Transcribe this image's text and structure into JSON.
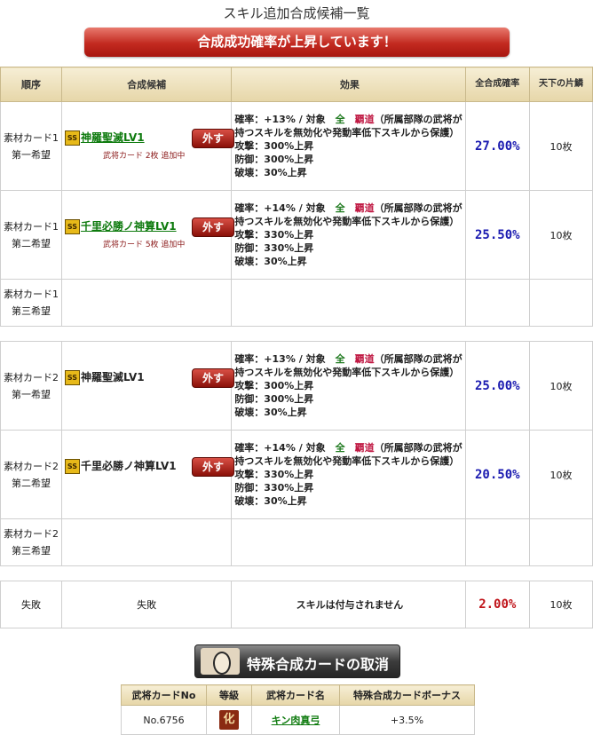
{
  "page_title": "スキル追加合成候補一覧",
  "banner": "合成成功確率が上昇しています！",
  "headers": {
    "order": "順序",
    "candidate": "合成候補",
    "effect": "効果",
    "total_rate": "全合成確率",
    "tenka": "天下の片鱗"
  },
  "rows": [
    {
      "order_line1": "素材カード1",
      "order_line2": "第一希望",
      "skill": "神羅聖滅LV1",
      "skill_linked": true,
      "sub": "武将カード 2枚 追加中",
      "remove": "外す",
      "effect": {
        "rate": "確率：+13%",
        "sep": "/",
        "target_label": "対象",
        "target": "全",
        "highlight": "覇道",
        "desc": "（所属部隊の武将が持つスキルを無効化や発動率低下スキルから保護）",
        "atk": "攻撃：300%上昇",
        "def": "防御：300%上昇",
        "brk": "破壊：30%上昇"
      },
      "total_rate": "27.00%",
      "tenka": "10枚"
    },
    {
      "order_line1": "素材カード1",
      "order_line2": "第二希望",
      "skill": "千里必勝ノ神算LV1",
      "skill_linked": true,
      "sub": "武将カード 5枚 追加中",
      "remove": "外す",
      "effect": {
        "rate": "確率：+14%",
        "sep": "/",
        "target_label": "対象",
        "target": "全",
        "highlight": "覇道",
        "desc": "（所属部隊の武将が持つスキルを無効化や発動率低下スキルから保護）",
        "atk": "攻撃：330%上昇",
        "def": "防御：330%上昇",
        "brk": "破壊：30%上昇"
      },
      "total_rate": "25.50%",
      "tenka": "10枚"
    },
    {
      "order_line1": "素材カード1",
      "order_line2": "第三希望"
    },
    {
      "order_line1": "素材カード2",
      "order_line2": "第一希望",
      "skill": "神羅聖滅LV1",
      "skill_linked": false,
      "sub": "",
      "remove": "外す",
      "effect": {
        "rate": "確率：+13%",
        "sep": "/",
        "target_label": "対象",
        "target": "全",
        "highlight": "覇道",
        "desc": "（所属部隊の武将が持つスキルを無効化や発動率低下スキルから保護）",
        "atk": "攻撃：300%上昇",
        "def": "防御：300%上昇",
        "brk": "破壊：30%上昇"
      },
      "total_rate": "25.00%",
      "tenka": "10枚"
    },
    {
      "order_line1": "素材カード2",
      "order_line2": "第二希望",
      "skill": "千里必勝ノ神算LV1",
      "skill_linked": false,
      "sub": "",
      "remove": "外す",
      "effect": {
        "rate": "確率：+14%",
        "sep": "/",
        "target_label": "対象",
        "target": "全",
        "highlight": "覇道",
        "desc": "（所属部隊の武将が持つスキルを無効化や発動率低下スキルから保護）",
        "atk": "攻撃：330%上昇",
        "def": "防御：330%上昇",
        "brk": "破壊：30%上昇"
      },
      "total_rate": "20.50%",
      "tenka": "10枚"
    },
    {
      "order_line1": "素材カード2",
      "order_line2": "第三希望"
    }
  ],
  "fail_row": {
    "order": "失敗",
    "candidate": "失敗",
    "effect": "スキルは付与されません",
    "total_rate": "2.00%",
    "tenka": "10枚"
  },
  "ss_badge": "SS",
  "special_cancel_button": "特殊合成カードの取消",
  "bonus_table": {
    "headers": [
      "武将カードNo",
      "等級",
      "武将カード名",
      "特殊合成カードボーナス"
    ],
    "row": {
      "no": "No.6756",
      "rank": "化",
      "name": "キン肉真弓",
      "bonus": "+3.5%"
    }
  }
}
